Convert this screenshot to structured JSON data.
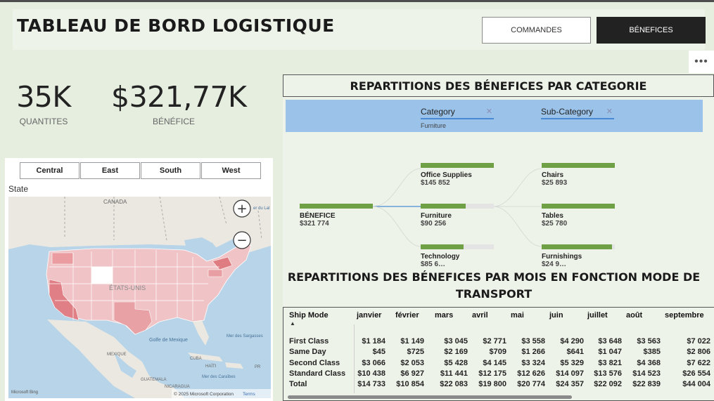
{
  "header": {
    "title": "TABLEAU DE BORD LOGISTIQUE",
    "nav": {
      "commandes_label": "COMMANDES",
      "benefices_label": "BÉNEFICES"
    },
    "more_label": "•••"
  },
  "kpis": {
    "quantity": {
      "value": "35K",
      "label": "QUANTITES"
    },
    "profit": {
      "value": "$321,77K",
      "label": "BÉNÉFICE"
    }
  },
  "map_card": {
    "regions": [
      "Central",
      "East",
      "South",
      "West"
    ],
    "state_label": "State",
    "labels": {
      "canada": "CANADA",
      "usa": "ÉTATS-UNIS",
      "mexico": "MEXIQUE",
      "gulf": "Golfe\nde Mexique",
      "sargasso": "Mer des Sargasses",
      "cuba": "CUBA",
      "haiti": "HAÏTI",
      "caribbean": "Mer\ndes Caraïbes",
      "guatemala": "GUATEMALA",
      "nicaragua": "NICARAGUA",
      "pr": "PR",
      "lake": "er du Lal",
      "copyright": "© 2025 Microsoft Corporation",
      "terms": "Terms",
      "bing": "Microsoft Bing"
    },
    "zoom_in": "+",
    "zoom_out": "−"
  },
  "tree": {
    "title": "REPARTITIONS DES BÉNEFICES PAR CATEGORIE",
    "filters": [
      {
        "label": "Category",
        "selected": "Furniture"
      },
      {
        "label": "Sub-Category",
        "selected": ""
      }
    ],
    "root": {
      "label": "BÉNEFICE",
      "value": "$321 774",
      "fill": 1.0
    },
    "categories": [
      {
        "label": "Office Supplies",
        "value": "$145 852",
        "fill": 1.0
      },
      {
        "label": "Furniture",
        "value": "$90 256",
        "fill": 0.62
      },
      {
        "label": "Technology",
        "value": "$85 6…",
        "fill": 0.59
      }
    ],
    "subcategories": [
      {
        "label": "Chairs",
        "value": "$25 893",
        "fill": 1.0
      },
      {
        "label": "Tables",
        "value": "$25 780",
        "fill": 1.0
      },
      {
        "label": "Furnishings",
        "value": "$24 9…",
        "fill": 0.96
      }
    ],
    "colors": {
      "bar": "#6fa046",
      "track": "#e4e4e4",
      "filter_bg": "#9bc3ea"
    }
  },
  "matrix": {
    "title": "REPARTITIONS DES BÉNEFICES PAR MOIS EN FONCTION MODE DE TRANSPORT",
    "row_header": "Ship Mode",
    "columns": [
      "janvier",
      "février",
      "mars",
      "avril",
      "mai",
      "juin",
      "juillet",
      "août",
      "septembre"
    ],
    "rows": [
      {
        "label": "First Class",
        "values": [
          "$1 184",
          "$1 149",
          "$3 045",
          "$2 771",
          "$3 558",
          "$4 290",
          "$3 648",
          "$3 563",
          "$7 022"
        ]
      },
      {
        "label": "Same Day",
        "values": [
          "$45",
          "$725",
          "$2 169",
          "$709",
          "$1 266",
          "$641",
          "$1 047",
          "$385",
          "$2 806"
        ]
      },
      {
        "label": "Second Class",
        "values": [
          "$3 066",
          "$2 053",
          "$5 428",
          "$4 145",
          "$3 324",
          "$5 329",
          "$3 821",
          "$4 368",
          "$7 622"
        ]
      },
      {
        "label": "Standard Class",
        "values": [
          "$10 438",
          "$6 927",
          "$11 441",
          "$12 175",
          "$12 626",
          "$14 097",
          "$13 576",
          "$14 523",
          "$26 554"
        ]
      },
      {
        "label": "Total",
        "values": [
          "$14 733",
          "$10 854",
          "$22 083",
          "$19 800",
          "$20 774",
          "$24 357",
          "$22 092",
          "$22 839",
          "$44 004"
        ]
      }
    ]
  }
}
